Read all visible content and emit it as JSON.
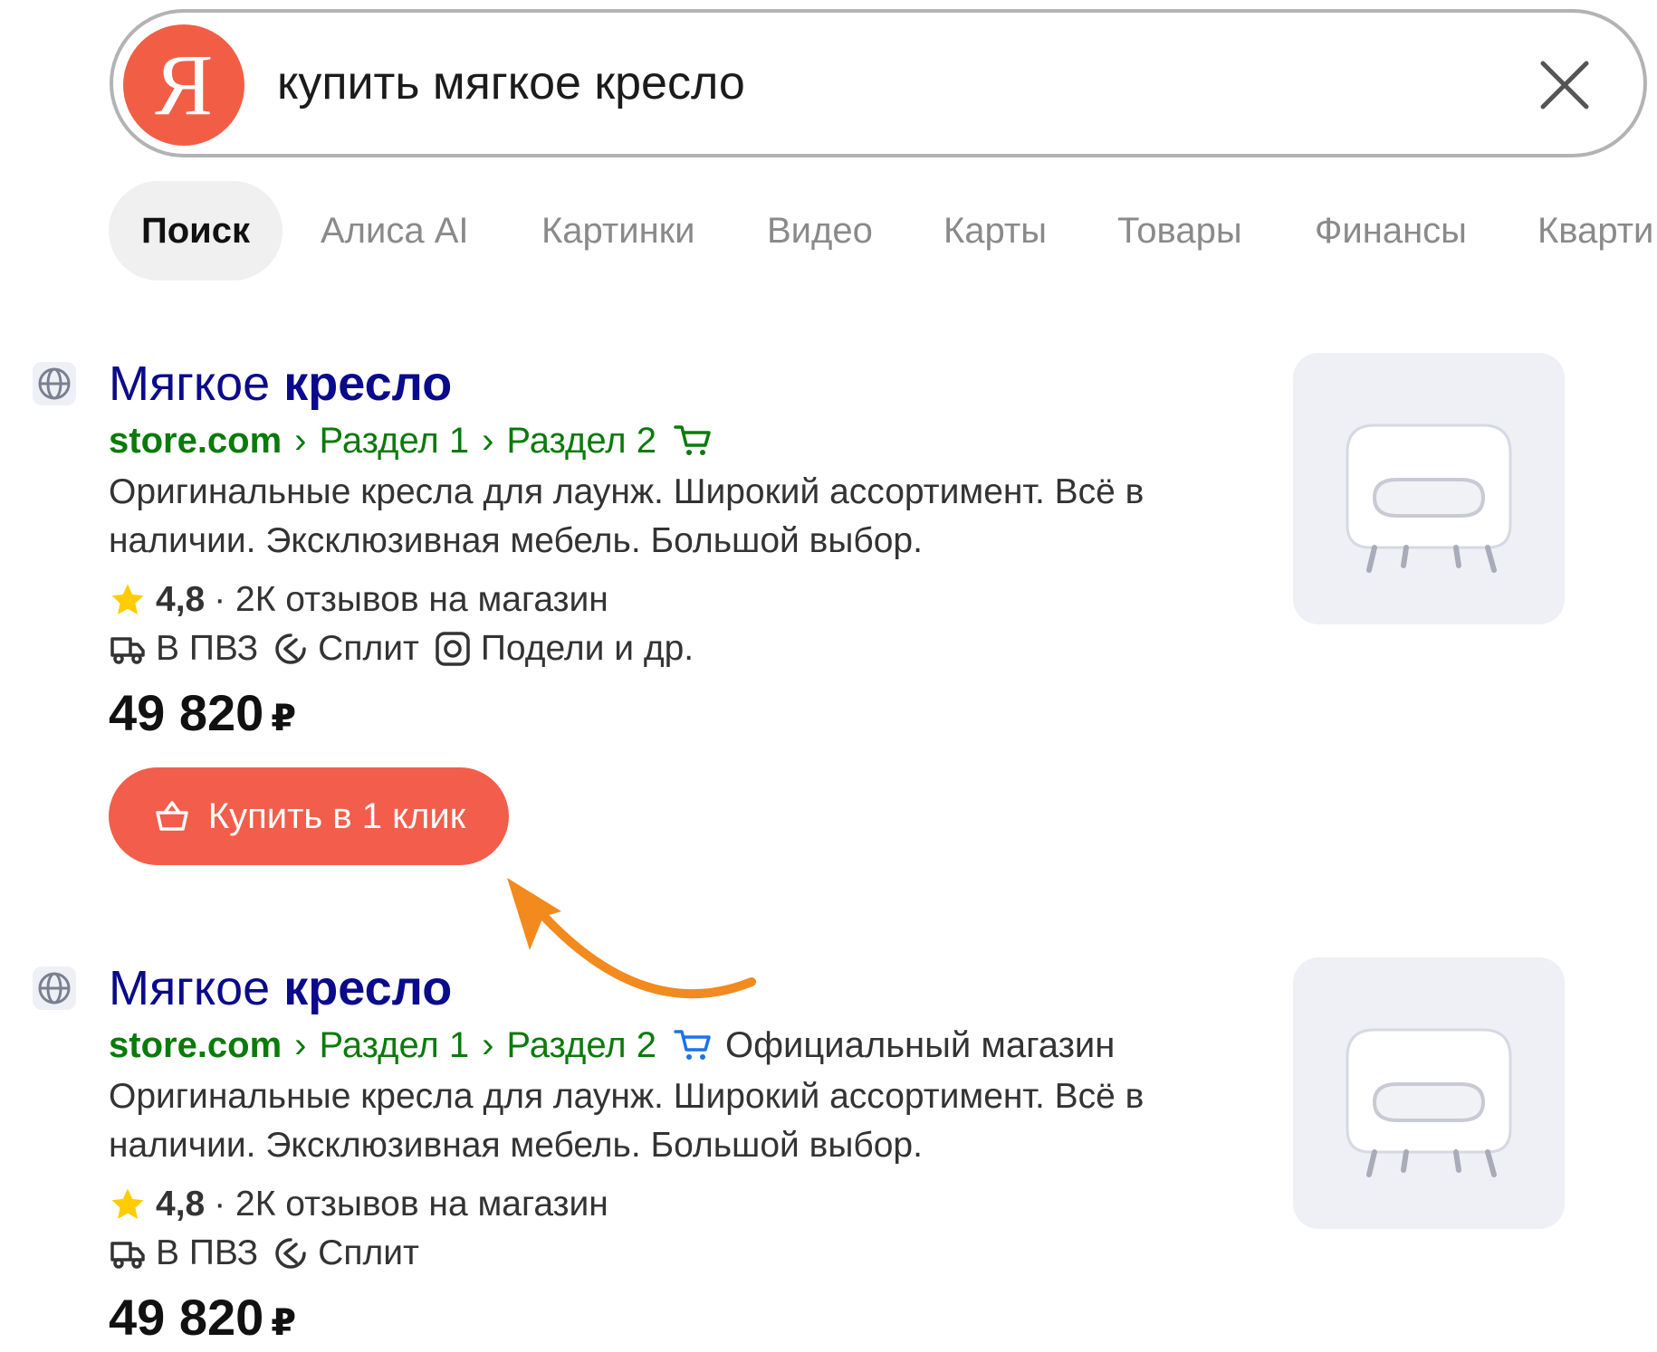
{
  "search": {
    "logo_letter": "Я",
    "query": "купить мягкое кресло"
  },
  "tabs": [
    {
      "label": "Поиск"
    },
    {
      "label": "Алиса AI"
    },
    {
      "label": "Картинки"
    },
    {
      "label": "Видео"
    },
    {
      "label": "Карты"
    },
    {
      "label": "Товары"
    },
    {
      "label": "Финансы"
    },
    {
      "label": "Кварти"
    }
  ],
  "results": [
    {
      "title_normal": "Мягкое",
      "title_bold": "кресло",
      "host": "store.com",
      "crumb1": "Раздел 1",
      "crumb2": "Раздел 2",
      "crumb_sep": "›",
      "official": "",
      "desc": "Оригинальные кресла для лаунж. Широкий ассортимент. Всё в наличии. Эксклюзивная мебель. Большой выбор.",
      "rating_value": "4,8",
      "rating_text": "· 2К отзывов на магазин",
      "feature_pvz": "В ПВЗ",
      "feature_split": "Сплит",
      "feature_podeli": "Подели и др.",
      "price": "49 820",
      "currency": "₽",
      "buy_label": "Купить в 1 клик"
    },
    {
      "title_normal": "Мягкое",
      "title_bold": "кресло",
      "host": "store.com",
      "crumb1": "Раздел 1",
      "crumb2": "Раздел 2",
      "crumb_sep": "›",
      "official": "Официальный магазин",
      "desc": "Оригинальные кресла для лаунж. Широкий ассортимент. Всё в наличии. Эксклюзивная мебель. Большой выбор.",
      "rating_value": "4,8",
      "rating_text": "· 2К отзывов на магазин",
      "feature_pvz": "В ПВЗ",
      "feature_split": "Сплит",
      "price": "49 820",
      "currency": "₽"
    }
  ],
  "colors": {
    "brand": "#f25e45",
    "title": "#0a0a8c",
    "url": "#0a7a0a",
    "arrow": "#f28a1e",
    "cart_green": "#0a7a0a",
    "cart_blue": "#1a73e8"
  }
}
